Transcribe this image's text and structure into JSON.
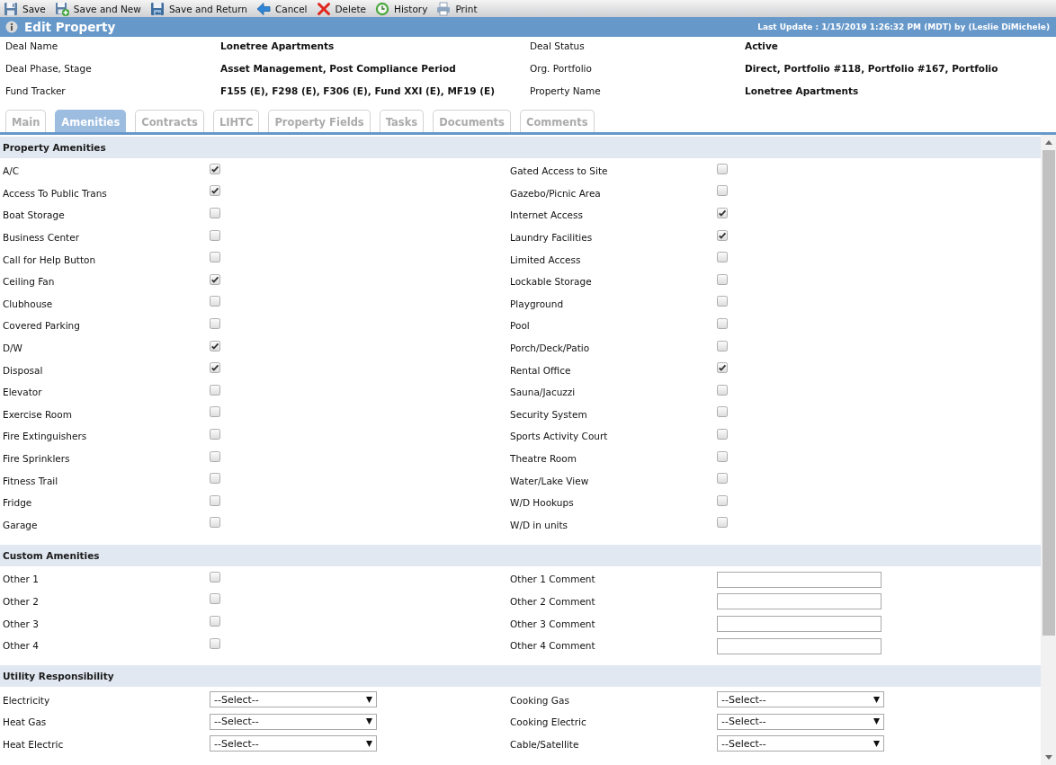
{
  "toolbar": [
    {
      "label": "Save"
    },
    {
      "label": "Save and New"
    },
    {
      "label": "Save and Return"
    },
    {
      "label": "Cancel"
    },
    {
      "label": "Delete"
    },
    {
      "label": "History"
    },
    {
      "label": "Print"
    }
  ],
  "page_header": {
    "title": "Edit Property",
    "last_update": "Last Update : 1/15/2019 1:26:32 PM (MDT) by (Leslie DiMichele)"
  },
  "deal_info": [
    {
      "label": "Deal Name",
      "value": "Lonetree Apartments"
    },
    {
      "label": "Deal Status",
      "value": "Active"
    },
    {
      "label": "Deal Phase, Stage",
      "value": "Asset Management, Post Compliance Period"
    },
    {
      "label": "Org. Portfolio",
      "value": "Direct, Portfolio #118, Portfolio #167, Portfolio"
    },
    {
      "label": "Fund Tracker",
      "value": "F155 (E), F298 (E), F306 (E), Fund XXI (E), MF19 (E)"
    },
    {
      "label": "Property Name",
      "value": "Lonetree Apartments"
    }
  ],
  "tabs": [
    {
      "label": "Main",
      "selected": false
    },
    {
      "label": "Amenities",
      "selected": true
    },
    {
      "label": "Contracts",
      "selected": false
    },
    {
      "label": "LIHTC",
      "selected": false
    },
    {
      "label": "Property Fields",
      "selected": false
    },
    {
      "label": "Tasks",
      "selected": false
    },
    {
      "label": "Documents",
      "selected": false
    },
    {
      "label": "Comments",
      "selected": false
    }
  ],
  "sections": [
    {
      "title": "Property Amenities",
      "fields": [
        {
          "label": "A/C",
          "kind": "checkbox",
          "checked": true
        },
        {
          "label": "Gated Access to Site",
          "kind": "checkbox",
          "checked": false
        },
        {
          "label": "Access To Public Trans",
          "kind": "checkbox",
          "checked": true
        },
        {
          "label": "Gazebo/Picnic Area",
          "kind": "checkbox",
          "checked": false
        },
        {
          "label": "Boat Storage",
          "kind": "checkbox",
          "checked": false
        },
        {
          "label": "Internet Access",
          "kind": "checkbox",
          "checked": true
        },
        {
          "label": "Business Center",
          "kind": "checkbox",
          "checked": false
        },
        {
          "label": "Laundry Facilities",
          "kind": "checkbox",
          "checked": true
        },
        {
          "label": "Call for Help Button",
          "kind": "checkbox",
          "checked": false
        },
        {
          "label": "Limited Access",
          "kind": "checkbox",
          "checked": false
        },
        {
          "label": "Ceiling Fan",
          "kind": "checkbox",
          "checked": true
        },
        {
          "label": "Lockable Storage",
          "kind": "checkbox",
          "checked": false
        },
        {
          "label": "Clubhouse",
          "kind": "checkbox",
          "checked": false
        },
        {
          "label": "Playground",
          "kind": "checkbox",
          "checked": false
        },
        {
          "label": "Covered Parking",
          "kind": "checkbox",
          "checked": false
        },
        {
          "label": "Pool",
          "kind": "checkbox",
          "checked": false
        },
        {
          "label": "D/W",
          "kind": "checkbox",
          "checked": true
        },
        {
          "label": "Porch/Deck/Patio",
          "kind": "checkbox",
          "checked": false
        },
        {
          "label": "Disposal",
          "kind": "checkbox",
          "checked": true
        },
        {
          "label": "Rental Office",
          "kind": "checkbox",
          "checked": true
        },
        {
          "label": "Elevator",
          "kind": "checkbox",
          "checked": false
        },
        {
          "label": "Sauna/Jacuzzi",
          "kind": "checkbox",
          "checked": false
        },
        {
          "label": "Exercise Room",
          "kind": "checkbox",
          "checked": false
        },
        {
          "label": "Security System",
          "kind": "checkbox",
          "checked": false
        },
        {
          "label": "Fire Extinguishers",
          "kind": "checkbox",
          "checked": false
        },
        {
          "label": "Sports Activity Court",
          "kind": "checkbox",
          "checked": false
        },
        {
          "label": "Fire Sprinklers",
          "kind": "checkbox",
          "checked": false
        },
        {
          "label": "Theatre Room",
          "kind": "checkbox",
          "checked": false
        },
        {
          "label": "Fitness Trail",
          "kind": "checkbox",
          "checked": false
        },
        {
          "label": "Water/Lake View",
          "kind": "checkbox",
          "checked": false
        },
        {
          "label": "Fridge",
          "kind": "checkbox",
          "checked": false
        },
        {
          "label": "W/D Hookups",
          "kind": "checkbox",
          "checked": false
        },
        {
          "label": "Garage",
          "kind": "checkbox",
          "checked": false
        },
        {
          "label": "W/D in units",
          "kind": "checkbox",
          "checked": false
        }
      ]
    },
    {
      "title": "Custom Amenities",
      "fields": [
        {
          "label": "Other 1",
          "kind": "checkbox",
          "checked": false
        },
        {
          "label": "Other 1 Comment",
          "kind": "text"
        },
        {
          "label": "Other 2",
          "kind": "checkbox",
          "checked": false
        },
        {
          "label": "Other 2 Comment",
          "kind": "text"
        },
        {
          "label": "Other 3",
          "kind": "checkbox",
          "checked": false
        },
        {
          "label": "Other 3 Comment",
          "kind": "text"
        },
        {
          "label": "Other 4",
          "kind": "checkbox",
          "checked": false
        },
        {
          "label": "Other 4 Comment",
          "kind": "text"
        }
      ]
    },
    {
      "title": "Utility Responsibility",
      "fields": [
        {
          "label": "Electricity",
          "kind": "select",
          "value": "--Select--"
        },
        {
          "label": "Cooking Gas",
          "kind": "select",
          "value": "--Select--"
        },
        {
          "label": "Heat Gas",
          "kind": "select",
          "value": "--Select--"
        },
        {
          "label": "Cooking Electric",
          "kind": "select",
          "value": "--Select--"
        },
        {
          "label": "Heat Electric",
          "kind": "select",
          "value": "--Select--"
        },
        {
          "label": "Cable/Satellite",
          "kind": "select",
          "value": "--Select--"
        }
      ]
    }
  ]
}
